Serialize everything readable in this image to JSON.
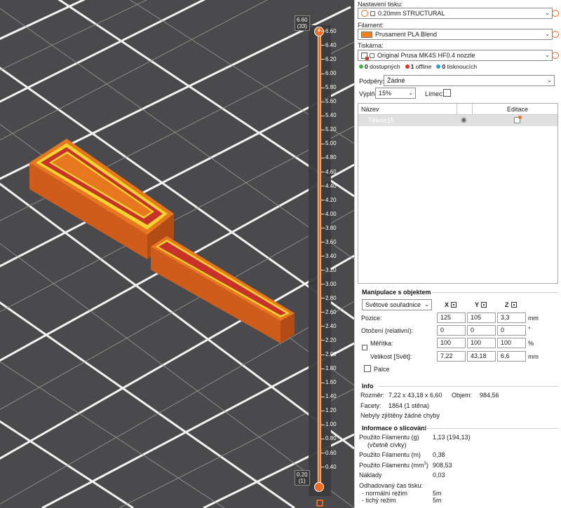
{
  "slider": {
    "top_value": "6.60",
    "top_layer": "(33)",
    "bottom_value": "0.20",
    "bottom_layer": "(1)",
    "ticks": [
      "6.60",
      "6.40",
      "6.20",
      "6.00",
      "5.80",
      "5.60",
      "5.40",
      "5.20",
      "5.00",
      "4.80",
      "4.60",
      "4.40",
      "4.20",
      "4.00",
      "3.80",
      "3.60",
      "3.40",
      "3.20",
      "3.00",
      "2.80",
      "2.60",
      "2.40",
      "2.20",
      "2.00",
      "1.80",
      "1.60",
      "1.40",
      "1.20",
      "1.00",
      "0.80",
      "0.60",
      "0.40"
    ],
    "upper_thumb_symbol": "+"
  },
  "print_settings": {
    "label": "Nastavení tisku:",
    "value": "0.20mm STRUCTURAL"
  },
  "filament": {
    "label": "Filament:",
    "value": "Prusament PLA Blend",
    "color": "#f07f1e"
  },
  "printer": {
    "label": "Tiskárna:",
    "value": "Original Prusa MK4S HF0.4 nozzle"
  },
  "printer_status": {
    "available_count": "0",
    "available_label": "dostupných",
    "offline_count": "1",
    "offline_label": "offline",
    "printing_count": "0",
    "printing_label": "tisknoucích"
  },
  "supports": {
    "label": "Podpěry:",
    "value": "Žádné"
  },
  "infill": {
    "label": "Výplň:",
    "value": "15%"
  },
  "brim": {
    "label": "Límec:"
  },
  "object_list": {
    "col_name": "Název",
    "col_edit": "Editace",
    "rows": [
      {
        "name": "Těleso15"
      }
    ]
  },
  "manipulation": {
    "title": "Manipulace s objektem",
    "coord_system": "Světové souřadnice",
    "axis_x": "X",
    "axis_y": "Y",
    "axis_z": "Z",
    "position_label": "Pozice:",
    "position": [
      "125",
      "105",
      "3,3"
    ],
    "position_unit": "mm",
    "rotation_label": "Otočení (relativní):",
    "rotation": [
      "0",
      "0",
      "0"
    ],
    "rotation_unit": "°",
    "scale_label": "Měřítka:",
    "scale": [
      "100",
      "100",
      "100"
    ],
    "scale_unit": "%",
    "size_label": "Velikost [Svět]:",
    "size": [
      "7,22",
      "43,18",
      "6,6"
    ],
    "size_unit": "mm",
    "inches_label": "Palce"
  },
  "info": {
    "title": "Info",
    "size_label": "Rozměr:",
    "size_value": "7,22 x 43,18 x 6,60",
    "volume_label": "Objem:",
    "volume_value": "984,56",
    "facets_label": "Facety:",
    "facets_value": "1864 (1 stěna)",
    "errors_text": "Nebyly zjištěny žádné chyby"
  },
  "slicing_info": {
    "title": "Informace o slicování",
    "filament_g_label": "Použito Filamentu (g)",
    "filament_g_sub": "(včetně cívky)",
    "filament_g_value": "1,13 (194,13)",
    "filament_m_label": "Použito Filamentu (m)",
    "filament_m_value": "0,38",
    "filament_mm3_label": "Použito Filamentu (mm",
    "filament_mm3_sup": "3",
    "filament_mm3_close": ")",
    "filament_mm3_value": "908,53",
    "cost_label": "Náklady",
    "cost_value": "0,03",
    "time_label": "Odhadovaný čas tisku:",
    "normal_mode_label": "- normální režim",
    "normal_mode_value": "5m",
    "silent_mode_label": "- tichý režim",
    "silent_mode_value": "5m"
  }
}
